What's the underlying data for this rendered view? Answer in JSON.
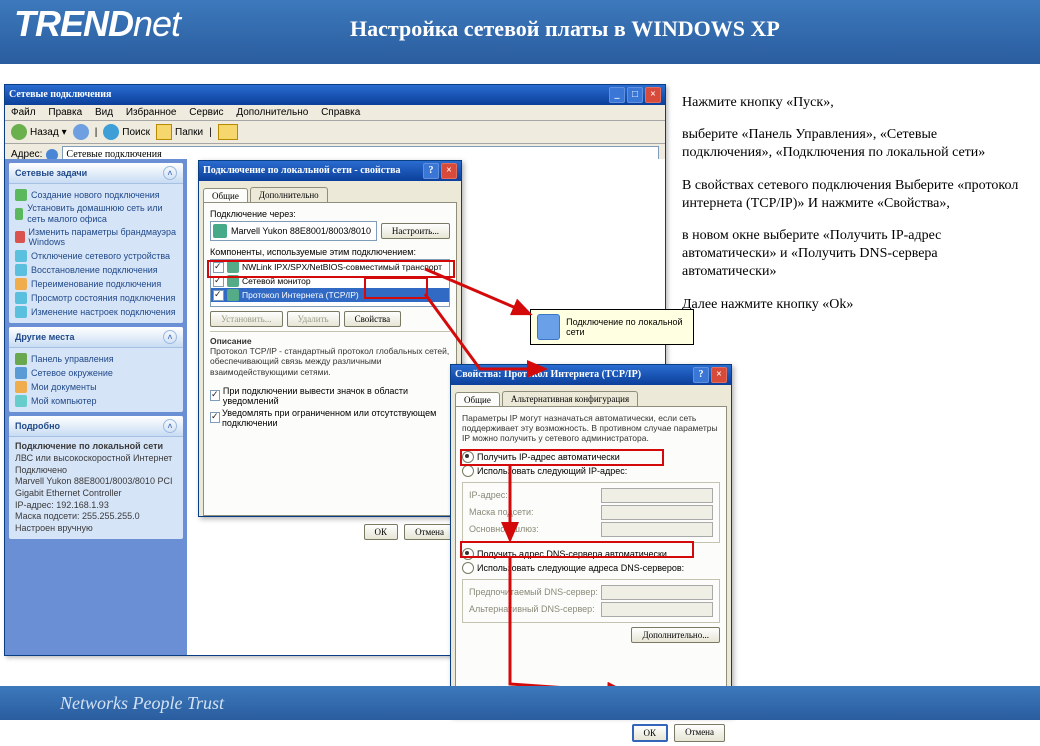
{
  "brand": {
    "logo_pre": "TREND",
    "logo_post": "net"
  },
  "title": "Настройка сетевой   платы   в WINDOWS XP",
  "footer": "Networks People Trust",
  "instructions": {
    "p1": "Нажмите кнопку «Пуск»,",
    "p2": "выберите «Панель Управления», «Сетевые подключения», «Подключения по локальной сети»",
    "p3": "В свойствах сетевого подключения Выберите «протокол интернета (TCP/IP)» И нажмите «Свойства»,",
    "p4": "в новом окне выберите «Получить IP-адрес автоматически» и «Получить DNS-сервера автоматически»",
    "p5": "Далее нажмите кнопку «Ok»"
  },
  "explorer": {
    "title": "Сетевые подключения",
    "menu": [
      "Файл",
      "Правка",
      "Вид",
      "Избранное",
      "Сервис",
      "Дополнительно",
      "Справка"
    ],
    "back": "Назад",
    "search": "Поиск",
    "folders": "Папки",
    "addr_label": "Адрес:",
    "addr_value": "Сетевые подключения",
    "tasks_head": "Сетевые задачи",
    "tasks": [
      "Создание нового подключения",
      "Установить домашнюю сеть или сеть малого офиса",
      "Изменить параметры брандмауэра Windows",
      "Отключение сетевого устройства",
      "Восстановление подключения",
      "Переименование подключения",
      "Просмотр состояния подключения",
      "Изменение настроек подключения"
    ],
    "places_head": "Другие места",
    "places": [
      "Панель управления",
      "Сетевое окружение",
      "Мои документы",
      "Мой компьютер"
    ],
    "details_head": "Подробно",
    "details_title": "Подключение по локальной сети",
    "details_sub": "ЛВС или высокоскоростной Интернет",
    "details_state": "Подключено",
    "details_hw": "Marvell Yukon 88E8001/8003/8010 PCI Gigabit Ethernet Controller",
    "details_ip": "IP-адрес: 192.168.1.93",
    "details_mask": "Маска подсети: 255.255.255.0",
    "details_mode": "Настроен вручную"
  },
  "props": {
    "title": "Подключение по локальной сети - свойства",
    "tab1": "Общие",
    "tab2": "Дополнительно",
    "conn_label": "Подключение через:",
    "adapter": "Marvell Yukon 88E8001/8003/8010",
    "configure": "Настроить...",
    "comp_label": "Компоненты, используемые этим подключением:",
    "items": [
      "NWLink IPX/SPX/NetBIOS-совместимый транспорт",
      "Сетевой монитор",
      "Протокол Интернета (TCP/IP)"
    ],
    "install": "Установить...",
    "remove": "Удалить",
    "properties": "Свойства",
    "desc_head": "Описание",
    "desc": "Протокол TCP/IP - стандартный протокол глобальных сетей, обеспечивающий связь между различными взаимодействующими сетями.",
    "chk1": "При подключении вывести значок в области уведомлений",
    "chk2": "Уведомлять при ограниченном или отсутствующем подключении",
    "ok": "ОК",
    "cancel": "Отмена"
  },
  "tooltip": "Подключение по локальной сети",
  "tcpip": {
    "title": "Свойства: Протокол Интернета (TCP/IP)",
    "tab1": "Общие",
    "tab2": "Альтернативная конфигурация",
    "intro": "Параметры IP могут назначаться автоматически, если сеть поддерживает эту возможность. В противном случае параметры IP можно получить у сетевого администратора.",
    "auto_ip": "Получить IP-адрес автоматически",
    "man_ip": "Использовать следующий IP-адрес:",
    "ip": "IP-адрес:",
    "mask": "Маска подсети:",
    "gw": "Основной шлюз:",
    "auto_dns": "Получить адрес DNS-сервера автоматически",
    "man_dns": "Использовать следующие адреса DNS-серверов:",
    "dns1": "Предпочитаемый DNS-сервер:",
    "dns2": "Альтернативный DNS-сервер:",
    "adv": "Дополнительно...",
    "ok": "ОК",
    "cancel": "Отмена"
  }
}
